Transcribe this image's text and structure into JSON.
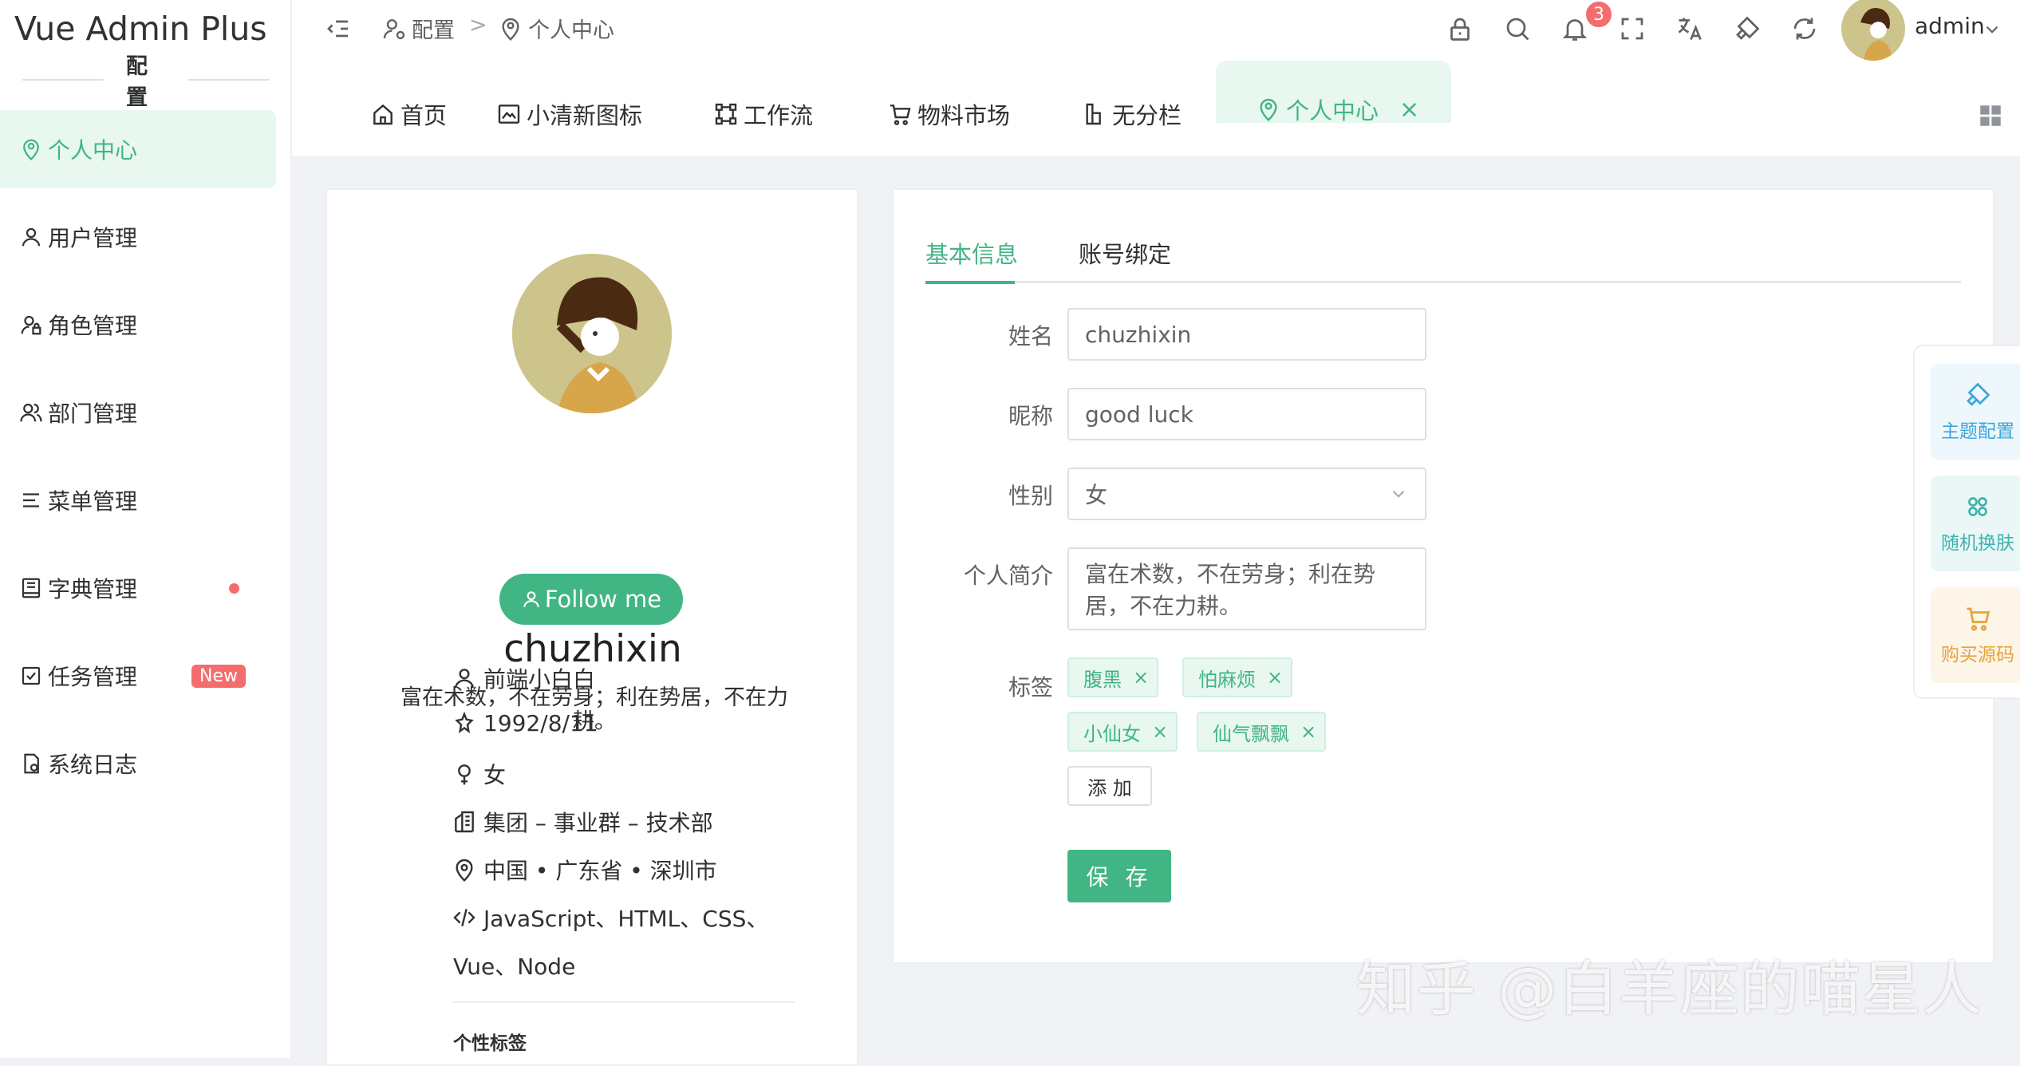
{
  "app": {
    "title": "Vue Admin Plus"
  },
  "sidebar": {
    "section": "配置",
    "items": [
      {
        "label": "个人中心",
        "icon": "location-user-icon",
        "active": true
      },
      {
        "label": "用户管理",
        "icon": "user-icon"
      },
      {
        "label": "角色管理",
        "icon": "user-lock-icon"
      },
      {
        "label": "部门管理",
        "icon": "team-icon"
      },
      {
        "label": "菜单管理",
        "icon": "menu-icon"
      },
      {
        "label": "字典管理",
        "icon": "book-icon",
        "dot": true
      },
      {
        "label": "任务管理",
        "icon": "checkbox-icon",
        "badge": "New"
      },
      {
        "label": "系统日志",
        "icon": "file-log-icon"
      }
    ]
  },
  "header": {
    "breadcrumb": [
      "配置",
      "个人中心"
    ],
    "breadcrumb_sep": ">",
    "notification_count": "3",
    "username": "admin"
  },
  "tabs": [
    {
      "label": "首页",
      "icon": "home-icon"
    },
    {
      "label": "小清新图标",
      "icon": "image-icon"
    },
    {
      "label": "工作流",
      "icon": "flow-icon"
    },
    {
      "label": "物料市场",
      "icon": "cart-icon"
    },
    {
      "label": "无分栏",
      "icon": "layout-icon"
    },
    {
      "label": "个人中心",
      "icon": "location-user-icon",
      "active": true,
      "close": "×"
    }
  ],
  "profile": {
    "name": "chuzhixin",
    "motto": "富在术数，不在劳身；利在势居，不在力耕。",
    "follow": "Follow me",
    "info": {
      "title": "前端小白白",
      "birthday": "1992/8/11",
      "gender": "女",
      "department": "集团 – 事业群 – 技术部",
      "location": "中国 • 广东省 • 深圳市",
      "skills": "JavaScript、HTML、CSS、",
      "skills2": "Vue、Node"
    },
    "tags_title": "个性标签"
  },
  "form": {
    "tabs": [
      "基本信息",
      "账号绑定"
    ],
    "labels": {
      "name": "姓名",
      "nickname": "昵称",
      "gender": "性别",
      "bio": "个人简介",
      "tags": "标签"
    },
    "values": {
      "name": "chuzhixin",
      "nickname": "good luck",
      "gender": "女",
      "bio_line1": "富在术数，不在劳身；利在势",
      "bio_line2": "居，不在力耕。"
    },
    "tags": [
      "腹黑",
      "怕麻烦",
      "小仙女",
      "仙气飘飘"
    ],
    "tag_close": "×",
    "add": "添 加",
    "save": "保 存"
  },
  "right_panel": {
    "theme": "主题配置",
    "random": "随机换肤",
    "buy": "购买源码"
  },
  "colors": {
    "primary": "#41b584",
    "danger": "#f56c6c",
    "warning": "#e6a23c"
  },
  "watermark": "知乎 @白羊座的喵星人"
}
